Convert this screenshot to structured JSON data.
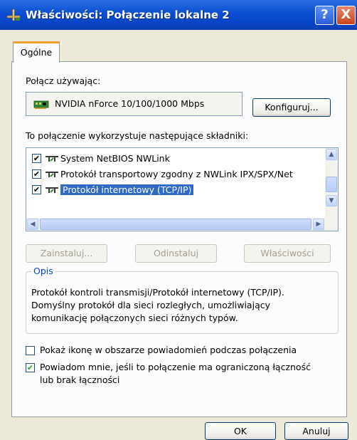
{
  "window": {
    "title": "Właściwości: Połączenie lokalne 2",
    "help_label": "?",
    "close_label": "X"
  },
  "tabs": [
    {
      "label": "Ogólne",
      "active": true
    }
  ],
  "connect_using": {
    "label": "Połącz używając:",
    "adapter": "NVIDIA nForce 10/100/1000 Mbps",
    "configure_button": "Konfiguruj..."
  },
  "components": {
    "label": "To połączenie wykorzystuje następujące składniki:",
    "items": [
      {
        "label": "System NetBIOS NWLink",
        "checked": true,
        "selected": false
      },
      {
        "label": "Protokół transportowy zgodny z NWLink IPX/SPX/Net",
        "checked": true,
        "selected": false
      },
      {
        "label": "Protokół internetowy (TCP/IP)",
        "checked": true,
        "selected": true
      }
    ],
    "buttons": {
      "install": "Zainstaluj...",
      "uninstall": "Odinstaluj",
      "properties": "Właściwości"
    }
  },
  "description": {
    "legend": "Opis",
    "lines": [
      "Protokół kontroli transmisji/Protokół internetowy (TCP/IP).",
      "Domyślny protokół dla sieci rozległych, umożliwiający",
      "komunikację połączonych sieci różnych typów."
    ]
  },
  "options": {
    "show_icon": {
      "label": "Pokaż ikonę w obszarze powiadomień podczas połączenia",
      "checked": false
    },
    "notify": {
      "label_line1": "Powiadom mnie, jeśli to połączenie ma ograniczoną łączność",
      "label_line2": "lub brak łączności",
      "checked": true
    }
  },
  "footer": {
    "ok": "OK",
    "cancel": "Anuluj"
  },
  "colors": {
    "title_bar": "#0a4dd2",
    "selection": "#316ac5",
    "group_legend": "#0046d5",
    "check": "#21a121"
  }
}
